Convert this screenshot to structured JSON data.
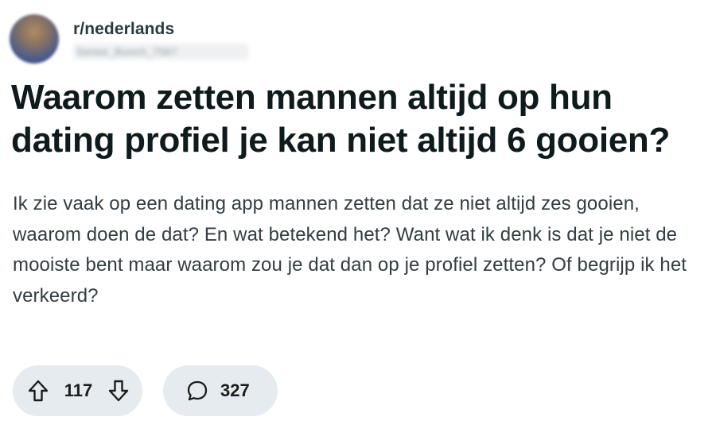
{
  "post": {
    "subreddit": "r/nederlands",
    "username": "Senior_Bunch_7567",
    "title": "Waarom zetten mannen altijd op hun dating profiel je kan niet altijd 6 gooien?",
    "body": "Ik zie vaak op een dating app mannen zetten dat ze niet altijd zes gooien, waarom doen de dat? En wat betekend het? Want wat ik denk is dat je niet de mooiste bent maar waarom zou je dat dan op je profiel zetten? Of begrijp ik het verkeerd?"
  },
  "actions": {
    "upvote_icon": "upvote-arrow-icon",
    "downvote_icon": "downvote-arrow-icon",
    "score": "117",
    "comment_icon": "speech-bubble-icon",
    "comments": "327"
  },
  "colors": {
    "pill_bg": "#e5ebee",
    "title": "#0f1a1c",
    "body_text": "#333d42"
  }
}
